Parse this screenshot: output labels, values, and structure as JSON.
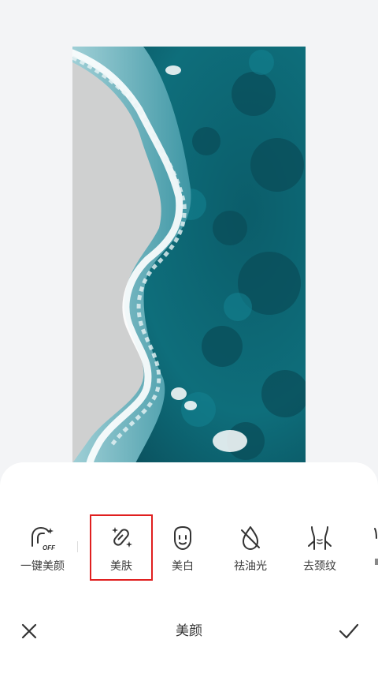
{
  "tools": [
    {
      "label": "一键美颜",
      "icon": "one-tap-beauty-off-icon",
      "badge": "OFF",
      "selected": false
    },
    {
      "label": "美肤",
      "icon": "skin-smoothing-icon",
      "selected": true
    },
    {
      "label": "美白",
      "icon": "whitening-face-icon",
      "selected": false
    },
    {
      "label": "祛油光",
      "icon": "oil-removal-icon",
      "selected": false
    },
    {
      "label": "去颈纹",
      "icon": "neck-wrinkle-icon",
      "selected": false
    }
  ],
  "footer": {
    "title": "美颜",
    "cancel_icon": "close-icon",
    "confirm_icon": "check-icon"
  },
  "colors": {
    "selection_border": "#e01f1f",
    "background": "#f3f4f6",
    "panel": "#ffffff",
    "icon_stroke": "#333333"
  }
}
